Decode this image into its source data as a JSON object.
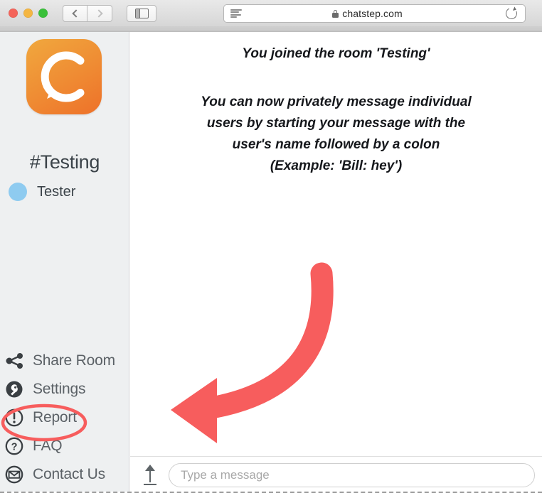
{
  "browser": {
    "traffic_lights": [
      "close",
      "minimize",
      "zoom"
    ],
    "back_label": "Back",
    "forward_label": "Forward",
    "sidebar_toggle_label": "Show Sidebar",
    "reader_label": "Reader View",
    "url": "chatstep.com",
    "reload_label": "Reload",
    "lock_label": "Secure connection",
    "colors": {
      "traffic_red": "#f4645a",
      "traffic_yellow": "#f4b642",
      "traffic_green": "#3ac03a"
    }
  },
  "sidebar": {
    "logo_name": "chatstep-logo",
    "logo_letter": "C",
    "room_name": "#Testing",
    "users": [
      {
        "name": "Tester",
        "status_color": "#8ecbf0"
      }
    ],
    "menu": [
      {
        "label": "Share Room",
        "icon": "share-icon"
      },
      {
        "label": "Settings",
        "icon": "settings-wrench-icon"
      },
      {
        "label": "Report",
        "icon": "report-alert-icon"
      },
      {
        "label": "FAQ",
        "icon": "question-mark-icon"
      },
      {
        "label": "Contact Us",
        "icon": "envelope-icon"
      }
    ],
    "colors": {
      "background": "#eef0f1",
      "text": "#5b6166",
      "logo_orange_light": "#f0a83e",
      "logo_orange_dark": "#ee7129"
    }
  },
  "chat": {
    "system_messages": [
      "You joined the room 'Testing'"
    ],
    "info_lines": [
      "You can now privately message individual",
      "users by starting your message with the",
      "user's name followed by a colon",
      "(Example: 'Bill: hey')"
    ]
  },
  "composer": {
    "upload_label": "Upload file",
    "placeholder": "Type a message",
    "value": ""
  },
  "annotations": {
    "arrow_color": "#f75d5d",
    "ellipse_color": "#f75d5d",
    "arrow_name": "red-curved-arrow-pointing-to-report",
    "ellipse_name": "red-ellipse-highlighting-report"
  }
}
